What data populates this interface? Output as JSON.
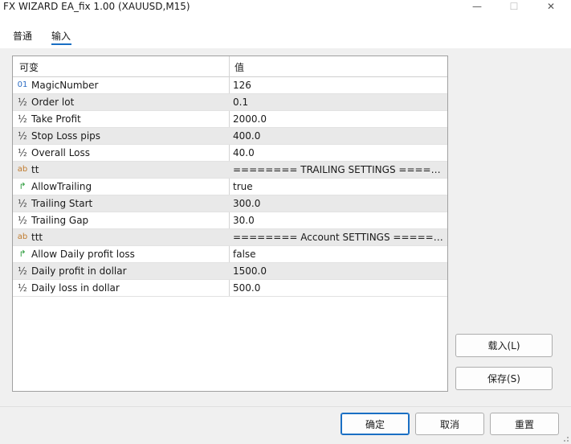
{
  "window": {
    "title": "FX WIZARD EA_fix 1.00 (XAUUSD,M15)",
    "minimize_glyph": "—",
    "maximize_glyph": "☐",
    "close_glyph": "✕"
  },
  "tabs": [
    {
      "label": "普通",
      "active": false
    },
    {
      "label": "输入",
      "active": true
    }
  ],
  "grid": {
    "col_variable": "可变",
    "col_value": "值",
    "rows": [
      {
        "icon": "01",
        "type": "int",
        "name": "MagicNumber",
        "value": "126"
      },
      {
        "icon": "½",
        "type": "double",
        "name": "Order lot",
        "value": "0.1"
      },
      {
        "icon": "½",
        "type": "double",
        "name": "Take Profit",
        "value": "2000.0"
      },
      {
        "icon": "½",
        "type": "double",
        "name": "Stop Loss pips",
        "value": "400.0"
      },
      {
        "icon": "½",
        "type": "double",
        "name": "Overall Loss",
        "value": "40.0"
      },
      {
        "icon": "ab",
        "type": "string",
        "name": "tt",
        "value": "======== TRAILING SETTINGS ======..."
      },
      {
        "icon": "↱",
        "type": "bool",
        "name": "AllowTrailing",
        "value": "true"
      },
      {
        "icon": "½",
        "type": "double",
        "name": "Trailing Start",
        "value": "300.0"
      },
      {
        "icon": "½",
        "type": "double",
        "name": "Trailing Gap",
        "value": "30.0"
      },
      {
        "icon": "ab",
        "type": "string",
        "name": "ttt",
        "value": "======== Account SETTINGS =======..."
      },
      {
        "icon": "↱",
        "type": "bool",
        "name": "Allow Daily profit loss",
        "value": "false"
      },
      {
        "icon": "½",
        "type": "double",
        "name": "Daily profit in dollar",
        "value": "1500.0"
      },
      {
        "icon": "½",
        "type": "double",
        "name": "Daily loss in dollar",
        "value": "500.0"
      }
    ]
  },
  "side_buttons": {
    "load": "载入(L)",
    "save": "保存(S)"
  },
  "bottom_buttons": {
    "ok": "确定",
    "cancel": "取消",
    "reset": "重置"
  },
  "colors": {
    "accent": "#1a6fc4",
    "alt_row": "#e9e9e9"
  }
}
